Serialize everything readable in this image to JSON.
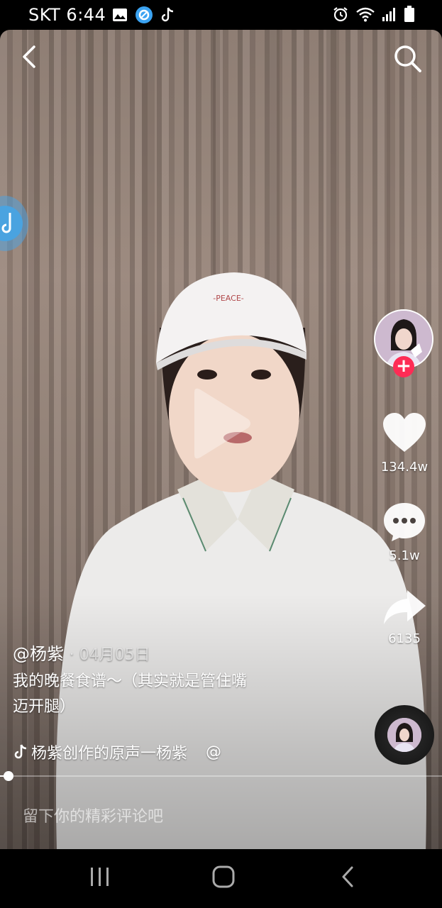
{
  "status_bar": {
    "carrier": "SKT",
    "time": "6:44",
    "left_icons": [
      "gallery-icon",
      "browser-app-icon",
      "tiktok-note-icon"
    ],
    "right_icons": [
      "alarm-icon",
      "wifi-icon",
      "signal-icon",
      "battery-icon"
    ]
  },
  "video": {
    "author": "@杨紫",
    "date": "· 04月05日",
    "description_line1": "我的晚餐食谱～（其实就是管住嘴",
    "description_line2": "迈开腿）",
    "sound": "杨紫创作的原声一杨紫",
    "sound_at": "@",
    "progress": 0.02
  },
  "actions": {
    "likes": "134.4w",
    "comments": "5.1w",
    "shares": "6135"
  },
  "follow_label": "+",
  "comment_placeholder": "留下你的精彩评论吧",
  "colors": {
    "accent": "#fe2c55",
    "background": "#000000",
    "text": "#ffffff"
  }
}
